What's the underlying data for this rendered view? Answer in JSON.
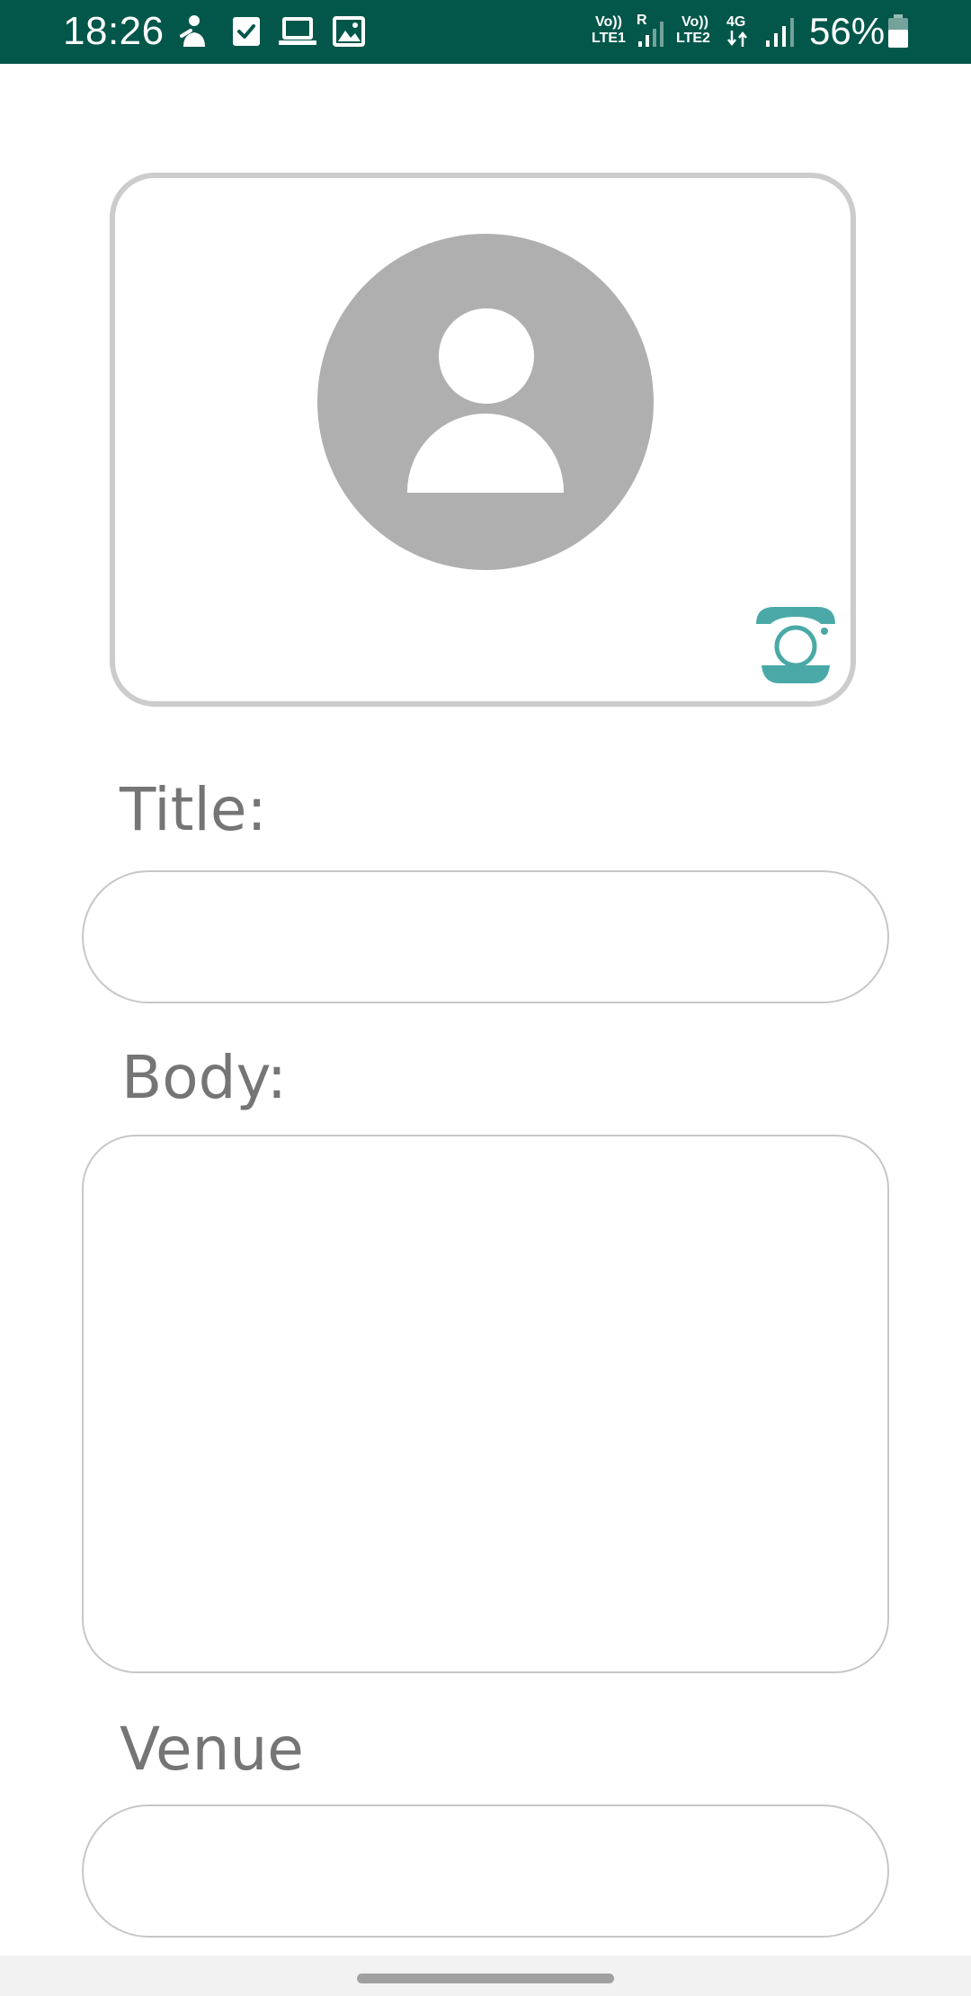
{
  "status_bar": {
    "time": "18:26",
    "battery_percent": "56%",
    "sim1_label_top": "Vo))",
    "sim1_label_bottom": "LTE1",
    "sim1_roaming": "R",
    "sim2_label_top": "Vo))",
    "sim2_label_bottom": "LTE2",
    "network_type": "4G",
    "icons": [
      "accessibility-icon",
      "checkbox-icon",
      "laptop-icon",
      "image-icon",
      "signal-icon",
      "battery-icon"
    ],
    "background_color": "#02574a"
  },
  "image_card": {
    "avatar_icon": "person-placeholder-icon",
    "camera_icon": "camera-icon",
    "camera_color": "#4aa9a6"
  },
  "form": {
    "title_label": "Title:",
    "title_value": "",
    "body_label": "Body:",
    "body_value": "",
    "venue_label": "Venue",
    "venue_value": ""
  },
  "nav_bar": {
    "home_indicator": "home-pill"
  }
}
